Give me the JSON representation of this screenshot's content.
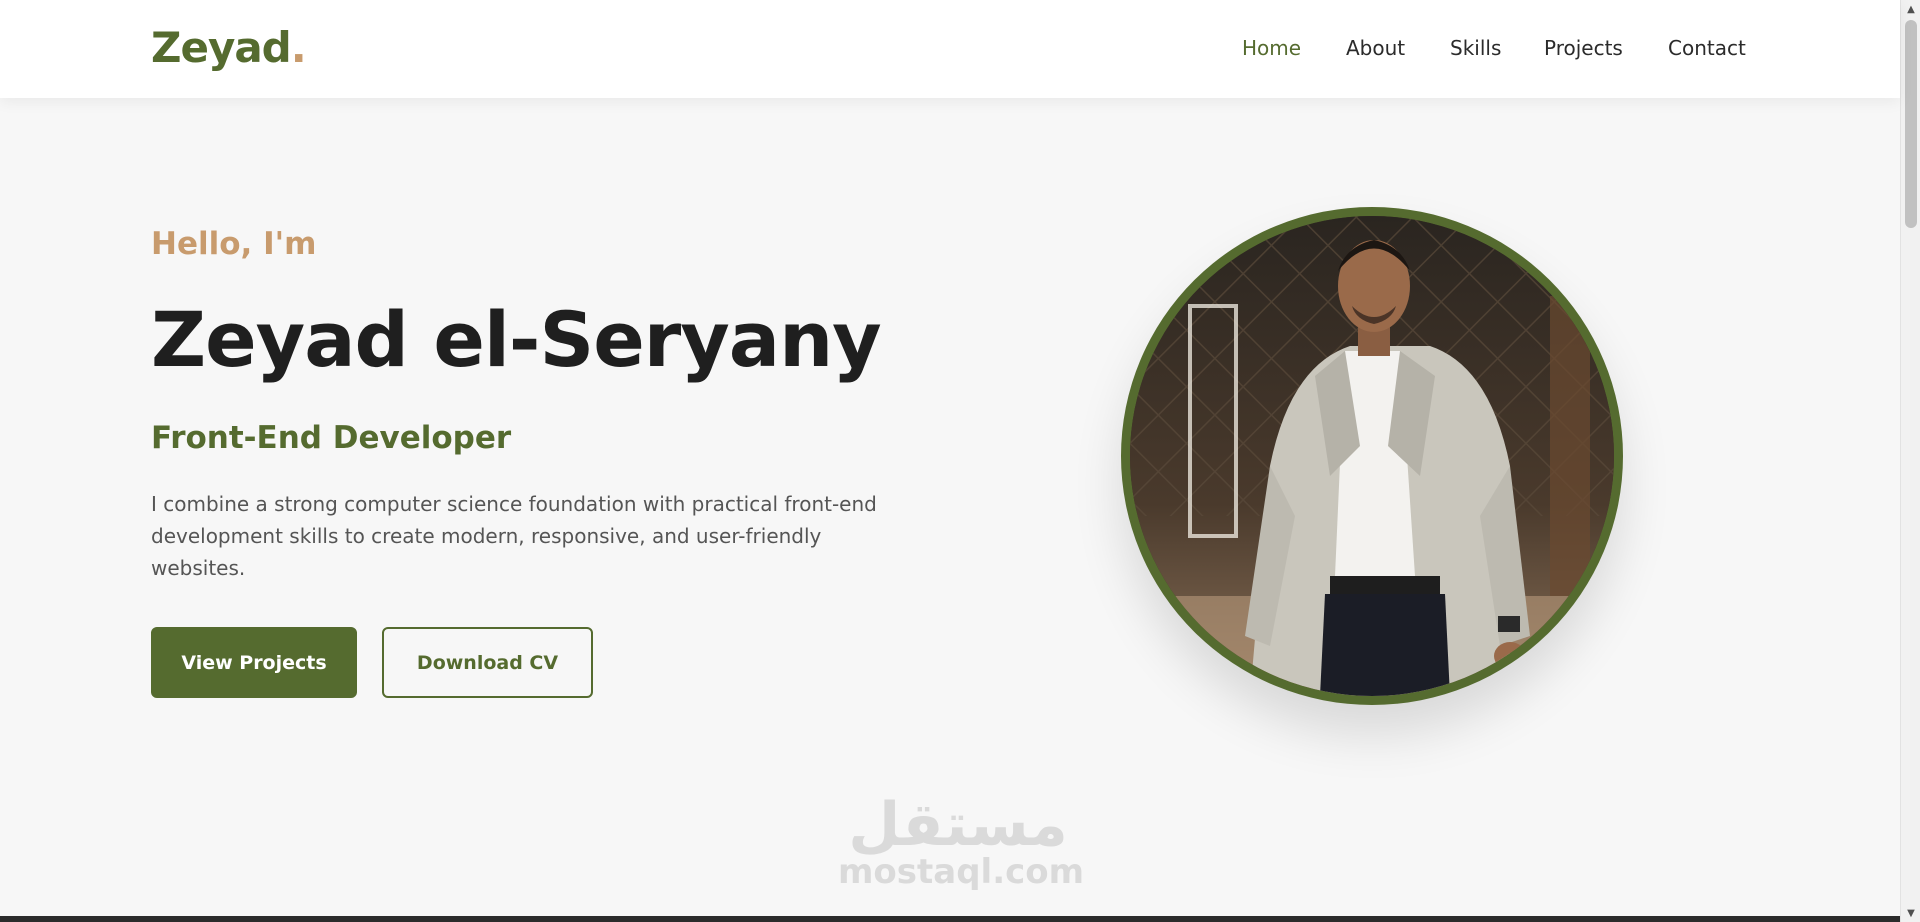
{
  "brand": {
    "name": "Zeyad",
    "dot": "."
  },
  "nav": {
    "items": [
      {
        "label": "Home",
        "active": true
      },
      {
        "label": "About",
        "active": false
      },
      {
        "label": "Skills",
        "active": false
      },
      {
        "label": "Projects",
        "active": false
      },
      {
        "label": "Contact",
        "active": false
      }
    ]
  },
  "hero": {
    "greeting": "Hello, I'm",
    "name": "Zeyad el-Seryany",
    "role": "Front-End Developer",
    "description": "I combine a strong computer science foundation with practical front-end development skills to create modern, responsive, and user-friendly websites.",
    "primary_button": "View Projects",
    "secondary_button": "Download CV"
  },
  "watermark": {
    "arabic": "مستقل",
    "latin": "mostaql.com"
  },
  "colors": {
    "accent": "#556b2f",
    "secondary_accent": "#c89b6d",
    "background": "#f7f7f7",
    "text": "#1f1f1f"
  },
  "icons": {
    "scroll_up": "arrow-up-icon",
    "scroll_down": "arrow-down-icon"
  }
}
